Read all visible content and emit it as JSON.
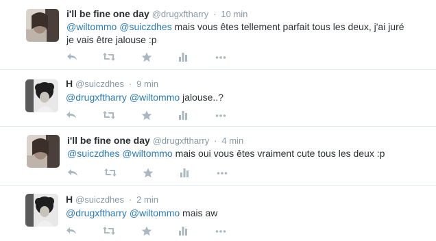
{
  "tweets": [
    {
      "name": "i'll be fine one day",
      "handle": "@drugxftharry",
      "dot": "·",
      "time": "10 min",
      "mentions": [
        "@wiltommo",
        "@suiczdhes"
      ],
      "text_line1": "mais vous êtes tellement parfait tous les deux, j'ai juré",
      "text_line2": "je vais être jalouse :p"
    },
    {
      "name": "H",
      "handle": "@suiczdhes",
      "dot": "·",
      "time": "9 min",
      "mentions": [
        "@drugxftharry",
        "@wiltommo"
      ],
      "text": "jalouse..?"
    },
    {
      "name": "i'll be fine one day",
      "handle": "@drugxftharry",
      "dot": "·",
      "time": "4 min",
      "mentions": [
        "@suiczdhes",
        "@wiltommo"
      ],
      "text": "mais oui vous êtes vraiment cute tous les deux :p"
    },
    {
      "name": "H",
      "handle": "@suiczdhes",
      "dot": "·",
      "time": "2 min",
      "mentions": [
        "@drugxftharry",
        "@wiltommo"
      ],
      "text": "mais aw"
    }
  ],
  "icons": [
    "reply-icon",
    "retweet-icon",
    "favorite-star-icon",
    "stats-icon",
    "more-icon"
  ],
  "colors": {
    "mention": "#2b7bb9",
    "meta": "#8899a6",
    "icon": "#aab8c2",
    "separator": "#e1e8ed"
  }
}
